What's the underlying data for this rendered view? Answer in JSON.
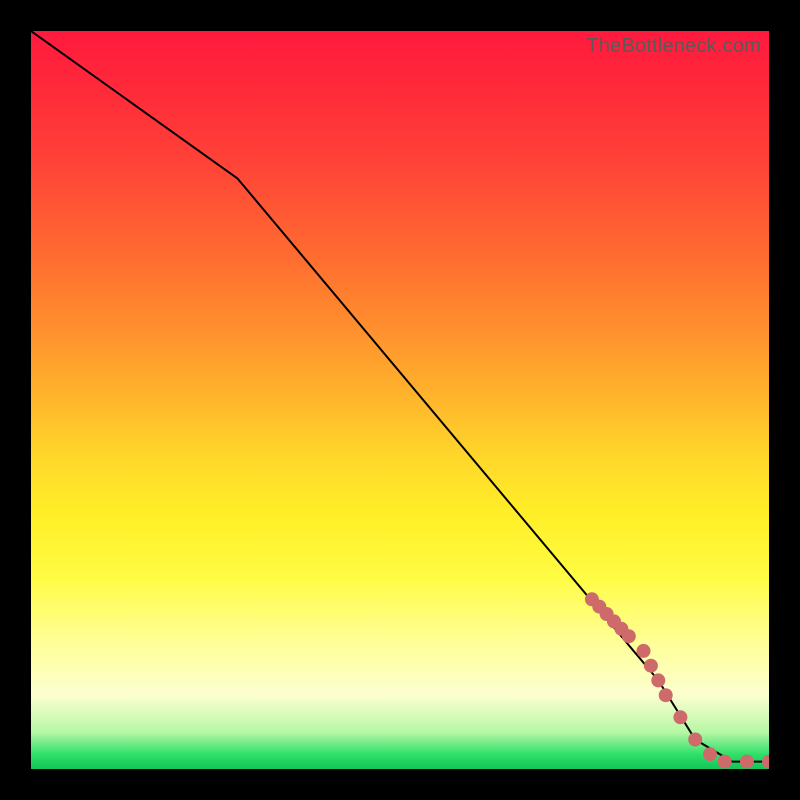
{
  "watermark": "TheBottleneck.com",
  "colors": {
    "dot": "#cf6a6b",
    "curve": "#000000",
    "frame": "#000000"
  },
  "chart_data": {
    "type": "line",
    "title": "",
    "xlabel": "",
    "ylabel": "",
    "xlim": [
      0,
      100
    ],
    "ylim": [
      0,
      100
    ],
    "grid": false,
    "series": [
      {
        "name": "curve",
        "kind": "line",
        "x": [
          0,
          28,
          85,
          90,
          95,
          100
        ],
        "y": [
          100,
          80,
          12,
          4,
          1,
          1
        ]
      },
      {
        "name": "dots",
        "kind": "scatter",
        "x": [
          76,
          77,
          78,
          79,
          80,
          81,
          83,
          84,
          85,
          86,
          88,
          90,
          92,
          94,
          97,
          100
        ],
        "y": [
          23,
          22,
          21,
          20,
          19,
          18,
          16,
          14,
          12,
          10,
          7,
          4,
          2,
          1,
          1,
          1
        ]
      }
    ]
  }
}
